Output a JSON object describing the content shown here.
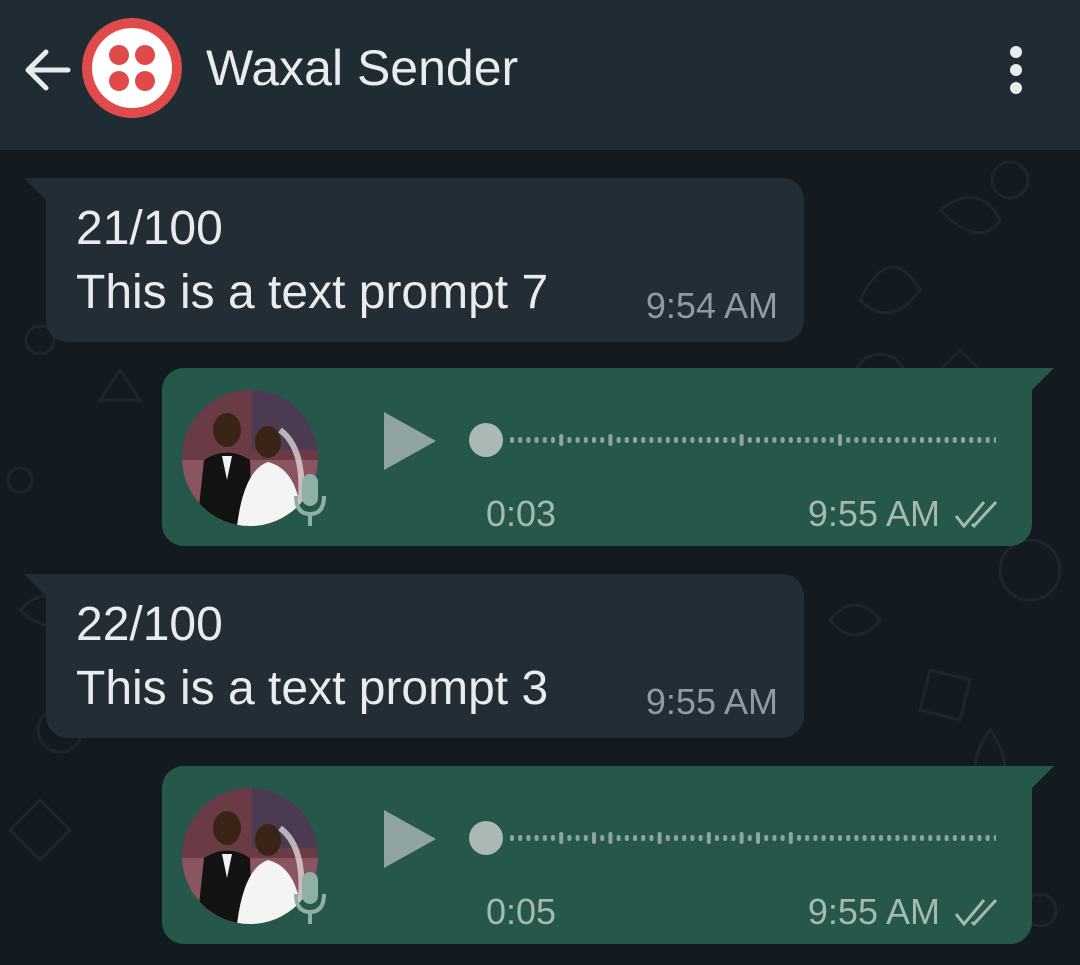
{
  "header": {
    "title": "Waxal Sender",
    "back_icon": "arrow-left-icon",
    "avatar_icon": "twilio-logo-icon",
    "menu_icon": "more-vertical-icon",
    "background_color": "#1f2c34",
    "logo_color": "#e14a4a"
  },
  "messages": [
    {
      "type": "text",
      "direction": "incoming",
      "counter": "21/100",
      "text": "This is a text prompt 7",
      "time": "9:54 AM"
    },
    {
      "type": "voice",
      "direction": "outgoing",
      "duration": "0:03",
      "time": "9:55 AM",
      "status_icon": "double-check-icon"
    },
    {
      "type": "text",
      "direction": "incoming",
      "counter": "22/100",
      "text": "This is a text prompt 3",
      "time": "9:55 AM"
    },
    {
      "type": "voice",
      "direction": "outgoing",
      "duration": "0:05",
      "time": "9:55 AM",
      "status_icon": "double-check-icon"
    }
  ],
  "colors": {
    "chat_background": "#131b20",
    "incoming_bubble": "#222d35",
    "outgoing_bubble": "#25584a",
    "primary_text": "#e8ecee",
    "secondary_text": "#8e9ba3"
  }
}
